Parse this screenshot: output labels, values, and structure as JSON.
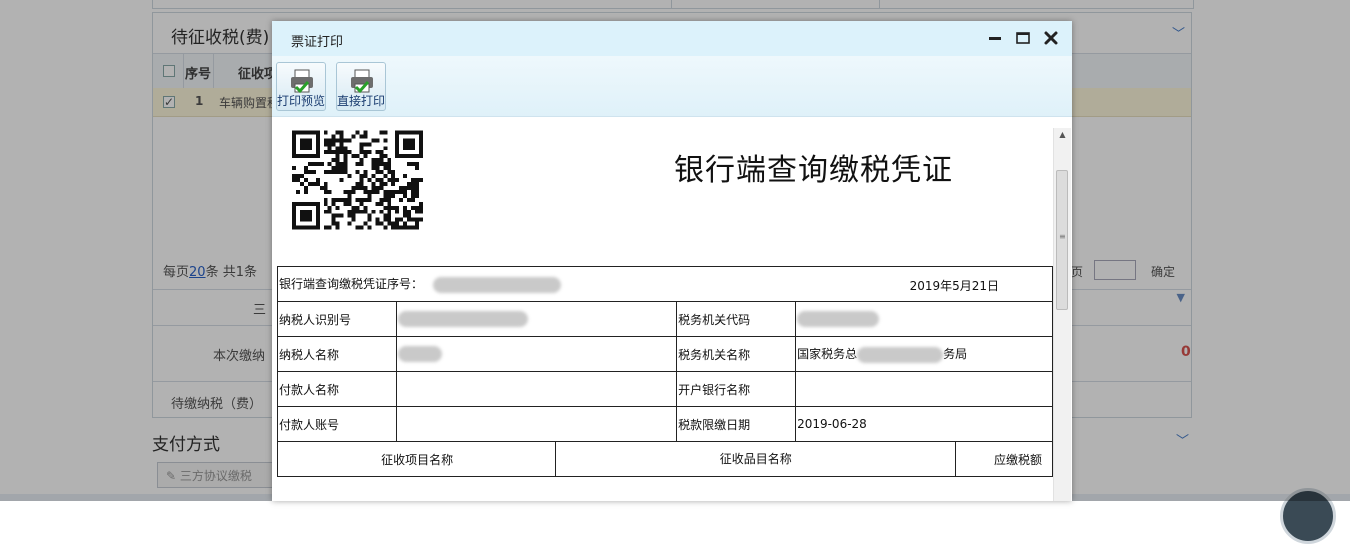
{
  "background": {
    "panel_title": "待征收税(费)",
    "grid_headers": [
      "序号",
      "征收项"
    ],
    "row": {
      "index": "1",
      "item": "车辆购置税"
    },
    "pager": {
      "prefix": "每页",
      "per_page": "20",
      "suffix": "条 共1条",
      "page_suffix": "页",
      "confirm": "确定"
    },
    "label_sanfang": "三",
    "label_current_pay": "本次缴纳",
    "current_pay_value": "0",
    "label_pending": "待缴纳税（费）",
    "section_payment": "支付方式",
    "pay_button": "三方协议缴税"
  },
  "dialog": {
    "title": "票证打印",
    "controls": {
      "minimize": "−",
      "maximize": "□",
      "close": "✕"
    },
    "toolbar": {
      "preview_label": "打印预览",
      "print_label": "直接打印"
    },
    "document": {
      "title": "银行端查询缴税凭证",
      "serial_label": "银行端查询缴税凭证序号：",
      "date": "2019年5月21日",
      "rows": [
        {
          "left_label": "纳税人识别号",
          "right_label": "税务机关代码",
          "right_value": ""
        },
        {
          "left_label": "纳税人名称",
          "right_label": "税务机关名称",
          "right_prefix": "国家税务总",
          "right_suffix": "务局"
        },
        {
          "left_label": "付款人名称",
          "right_label": "开户银行名称",
          "right_value": ""
        },
        {
          "left_label": "付款人账号",
          "right_label": "税款限缴日期",
          "right_value": "2019-06-28"
        }
      ],
      "columns": [
        "征收项目名称",
        "征收品目名称",
        "应缴税额"
      ]
    }
  }
}
